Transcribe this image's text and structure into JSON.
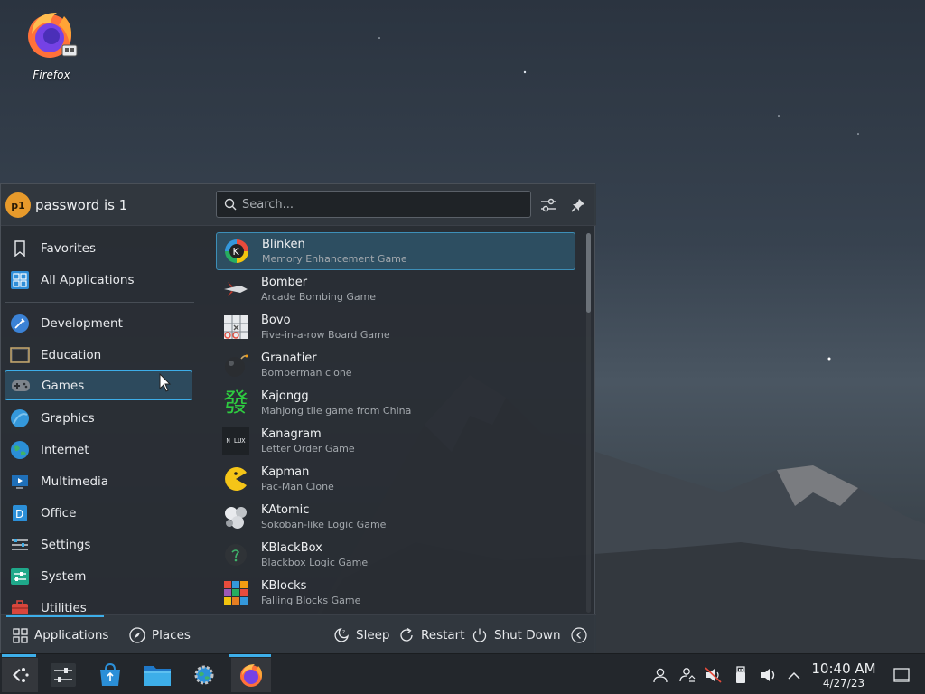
{
  "desktop": {
    "icons": [
      {
        "label": "Firefox",
        "icon": "firefox-icon"
      }
    ]
  },
  "launcher": {
    "user": {
      "avatar_text": "p1",
      "name": "password is 1"
    },
    "search": {
      "placeholder": "Search...",
      "value": ""
    },
    "header_buttons": [
      {
        "icon": "configure-icon"
      },
      {
        "icon": "pin-icon"
      }
    ],
    "sidebar": {
      "top": [
        {
          "label": "Favorites",
          "icon": "bookmark-icon"
        },
        {
          "label": "All Applications",
          "icon": "grid-icon"
        }
      ],
      "categories": [
        {
          "label": "Development",
          "icon": "development-icon"
        },
        {
          "label": "Education",
          "icon": "education-icon"
        },
        {
          "label": "Games",
          "icon": "gamepad-icon",
          "selected": true
        },
        {
          "label": "Graphics",
          "icon": "graphics-icon"
        },
        {
          "label": "Internet",
          "icon": "globe-icon"
        },
        {
          "label": "Multimedia",
          "icon": "multimedia-icon"
        },
        {
          "label": "Office",
          "icon": "office-icon"
        },
        {
          "label": "Settings",
          "icon": "settings-icon"
        },
        {
          "label": "System",
          "icon": "system-icon"
        },
        {
          "label": "Utilities",
          "icon": "utilities-icon"
        }
      ]
    },
    "apps": [
      {
        "name": "Blinken",
        "desc": "Memory Enhancement Game",
        "icon": "blinken-icon",
        "selected": true
      },
      {
        "name": "Bomber",
        "desc": "Arcade Bombing Game",
        "icon": "bomber-icon"
      },
      {
        "name": "Bovo",
        "desc": "Five-in-a-row Board Game",
        "icon": "bovo-icon"
      },
      {
        "name": "Granatier",
        "desc": "Bomberman clone",
        "icon": "granatier-icon"
      },
      {
        "name": "Kajongg",
        "desc": "Mahjong tile game from China",
        "icon": "kajongg-icon",
        "glyph": "發"
      },
      {
        "name": "Kanagram",
        "desc": "Letter Order Game",
        "icon": "kanagram-icon",
        "glyph": "N LUX"
      },
      {
        "name": "Kapman",
        "desc": "Pac-Man Clone",
        "icon": "kapman-icon"
      },
      {
        "name": "KAtomic",
        "desc": "Sokoban-like Logic Game",
        "icon": "katomic-icon"
      },
      {
        "name": "KBlackBox",
        "desc": "Blackbox Logic Game",
        "icon": "kblackbox-icon"
      },
      {
        "name": "KBlocks",
        "desc": "Falling Blocks Game",
        "icon": "kblocks-icon"
      }
    ],
    "footer": {
      "tabs": [
        {
          "label": "Applications",
          "icon": "applications-grid-icon",
          "active": true
        },
        {
          "label": "Places",
          "icon": "compass-icon"
        }
      ],
      "power": [
        {
          "label": "Sleep",
          "icon": "sleep-icon"
        },
        {
          "label": "Restart",
          "icon": "restart-icon"
        },
        {
          "label": "Shut Down",
          "icon": "power-icon"
        }
      ],
      "more_icon": "chevron-left-icon"
    }
  },
  "taskbar": {
    "items": [
      {
        "icon": "kde-launcher-icon",
        "active": true
      },
      {
        "icon": "system-settings-icon"
      },
      {
        "icon": "discover-icon"
      },
      {
        "icon": "dolphin-folder-icon"
      },
      {
        "icon": "system-monitor-icon"
      },
      {
        "icon": "firefox-icon",
        "active": true
      }
    ],
    "tray": [
      {
        "icon": "user-icon"
      },
      {
        "icon": "user-switch-icon"
      },
      {
        "icon": "mute-icon"
      },
      {
        "icon": "usb-icon"
      },
      {
        "icon": "volume-icon"
      },
      {
        "icon": "chevron-up-icon"
      }
    ],
    "clock": {
      "time": "10:40 AM",
      "date": "4/27/23"
    },
    "show_desktop_icon": "show-desktop-icon"
  }
}
